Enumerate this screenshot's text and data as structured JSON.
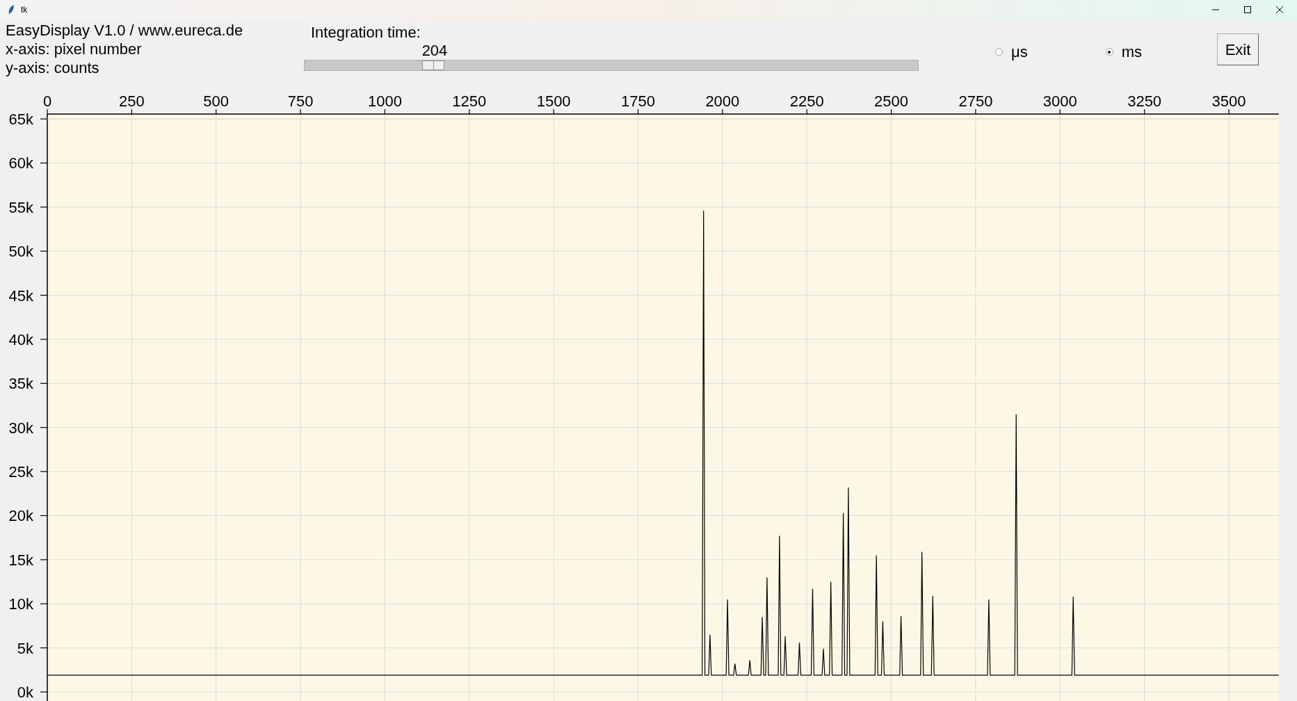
{
  "window": {
    "title": "tk"
  },
  "header": {
    "lines": [
      "EasyDisplay V1.0 / www.eureca.de",
      "x-axis: pixel number",
      "y-axis: counts"
    ]
  },
  "integration": {
    "label": "Integration time:",
    "value": "204",
    "level": 0.21
  },
  "units": [
    {
      "label": "μs",
      "selected": false
    },
    {
      "label": "ms",
      "selected": true
    }
  ],
  "exit_button": "Exit",
  "chart_data": {
    "type": "line",
    "grid": true,
    "xlim": [
      0,
      3648
    ],
    "ylim": [
      0,
      65000
    ],
    "xticks": [
      0,
      250,
      500,
      750,
      1000,
      1250,
      1500,
      1750,
      2000,
      2250,
      2500,
      2750,
      3000,
      3250,
      3500
    ],
    "yticks": [
      {
        "value": 0,
        "label": "0k"
      },
      {
        "value": 5000,
        "label": "5k"
      },
      {
        "value": 10000,
        "label": "10k"
      },
      {
        "value": 15000,
        "label": "15k"
      },
      {
        "value": 20000,
        "label": "20k"
      },
      {
        "value": 25000,
        "label": "25k"
      },
      {
        "value": 30000,
        "label": "30k"
      },
      {
        "value": 35000,
        "label": "35k"
      },
      {
        "value": 40000,
        "label": "40k"
      },
      {
        "value": 45000,
        "label": "45k"
      },
      {
        "value": 50000,
        "label": "50k"
      },
      {
        "value": 55000,
        "label": "55k"
      },
      {
        "value": 60000,
        "label": "60k"
      },
      {
        "value": 65000,
        "label": "65k"
      }
    ],
    "x": [
      0,
      1940,
      1944,
      1948,
      1959,
      1963,
      1967,
      2011,
      2015,
      2019,
      2033,
      2037,
      2041,
      2077,
      2081,
      2085,
      2114,
      2118,
      2122,
      2128,
      2132,
      2136,
      2165,
      2169,
      2173,
      2182,
      2186,
      2190,
      2224,
      2228,
      2232,
      2263,
      2267,
      2271,
      2295,
      2299,
      2303,
      2317,
      2321,
      2325,
      2354,
      2358,
      2362,
      2369,
      2373,
      2377,
      2452,
      2456,
      2460,
      2471,
      2475,
      2479,
      2525,
      2529,
      2533,
      2587,
      2591,
      2595,
      2619,
      2623,
      2627,
      2785,
      2789,
      2793,
      2866,
      2870,
      2874,
      3035,
      3039,
      3043,
      3648
    ],
    "series": [
      {
        "color": "#000000",
        "values": [
          1900,
          1900,
          54600,
          1900,
          1900,
          6500,
          1900,
          1900,
          10500,
          1900,
          1900,
          3200,
          1900,
          1900,
          3600,
          1900,
          1900,
          8500,
          1900,
          1900,
          13000,
          1900,
          1900,
          17700,
          1900,
          1900,
          6300,
          1900,
          1900,
          5600,
          1900,
          1900,
          11700,
          1900,
          1900,
          4900,
          1900,
          1900,
          12500,
          1900,
          1900,
          20300,
          1900,
          1900,
          23200,
          1900,
          1900,
          15500,
          1900,
          1900,
          8000,
          1900,
          1900,
          8600,
          1900,
          1900,
          15900,
          1900,
          1900,
          10900,
          1900,
          1900,
          10500,
          1900,
          1900,
          31500,
          1900,
          1900,
          10800,
          1900,
          1900
        ]
      }
    ]
  }
}
